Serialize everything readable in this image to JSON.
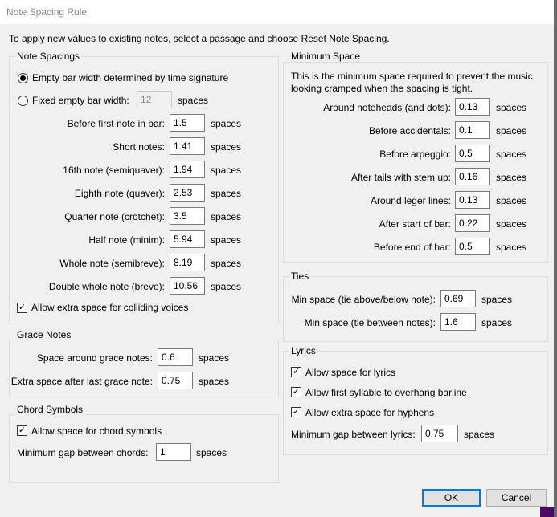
{
  "window": {
    "title": "Note Spacing Rule"
  },
  "intro": "To apply new values to existing notes, select a passage and choose Reset Note Spacing.",
  "note_spacings": {
    "title": "Note Spacings",
    "radio_time_sig": "Empty bar width determined by time signature",
    "radio_fixed": "Fixed empty bar width:",
    "fixed_value": "12",
    "fixed_unit": "spaces",
    "rows": [
      {
        "label": "Before first note in bar:",
        "value": "1.5",
        "unit": "spaces"
      },
      {
        "label": "Short notes:",
        "value": "1.41",
        "unit": "spaces"
      },
      {
        "label": "16th note (semiquaver):",
        "value": "1.94",
        "unit": "spaces"
      },
      {
        "label": "Eighth note (quaver):",
        "value": "2.53",
        "unit": "spaces"
      },
      {
        "label": "Quarter note (crotchet):",
        "value": "3.5",
        "unit": "spaces"
      },
      {
        "label": "Half note (minim):",
        "value": "5.94",
        "unit": "spaces"
      },
      {
        "label": "Whole note (semibreve):",
        "value": "8.19",
        "unit": "spaces"
      },
      {
        "label": "Double whole note (breve):",
        "value": "10.56",
        "unit": "spaces"
      }
    ],
    "allow_colliding": "Allow extra space for colliding voices"
  },
  "grace_notes": {
    "title": "Grace Notes",
    "rows": [
      {
        "label": "Space around grace notes:",
        "value": "0.6",
        "unit": "spaces"
      },
      {
        "label": "Extra space after last grace note:",
        "value": "0.75",
        "unit": "spaces"
      }
    ]
  },
  "chord_symbols": {
    "title": "Chord Symbols",
    "allow_space": "Allow space for chord symbols",
    "min_gap_label": "Minimum gap between chords:",
    "min_gap_value": "1",
    "min_gap_unit": "spaces"
  },
  "minimum_space": {
    "title": "Minimum Space",
    "description_line1": "This is the minimum space required to prevent the music",
    "description_line2": "looking cramped when the spacing is tight.",
    "rows": [
      {
        "label": "Around noteheads (and dots):",
        "value": "0.13",
        "unit": "spaces"
      },
      {
        "label": "Before accidentals:",
        "value": "0.1",
        "unit": "spaces"
      },
      {
        "label": "Before arpeggio:",
        "value": "0.5",
        "unit": "spaces"
      },
      {
        "label": "After tails with stem up:",
        "value": "0.16",
        "unit": "spaces"
      },
      {
        "label": "Around leger lines:",
        "value": "0.13",
        "unit": "spaces"
      },
      {
        "label": "After start of bar:",
        "value": "0.22",
        "unit": "spaces"
      },
      {
        "label": "Before end of bar:",
        "value": "0.5",
        "unit": "spaces"
      }
    ]
  },
  "ties": {
    "title": "Ties",
    "rows": [
      {
        "label": "Min space (tie above/below note):",
        "value": "0.69",
        "unit": "spaces"
      },
      {
        "label": "Min space (tie between notes):",
        "value": "1.6",
        "unit": "spaces"
      }
    ]
  },
  "lyrics": {
    "title": "Lyrics",
    "allow_space": "Allow space for lyrics",
    "allow_overhang": "Allow first syllable to overhang barline",
    "allow_hyphens": "Allow extra space for hyphens",
    "min_gap_label": "Minimum gap between lyrics:",
    "min_gap_value": "0.75",
    "min_gap_unit": "spaces"
  },
  "buttons": {
    "ok": "OK",
    "cancel": "Cancel"
  },
  "colors": {
    "default_button_border": "#0078d7",
    "title_text": "#8a8a8a"
  }
}
